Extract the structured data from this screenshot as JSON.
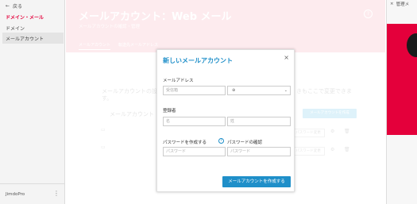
{
  "sidebar": {
    "back_label": "戻る",
    "section_title": "ドメイン・メール",
    "items": [
      {
        "label": "ドメイン"
      },
      {
        "label": "メールアカウント"
      }
    ],
    "footer_brand": "JimdoPro",
    "footer_menu": "⋮"
  },
  "header": {
    "title": "メールアカウント：Web メール",
    "subtitle": "メールアカウントの確認・管理",
    "help": "?",
    "tabs": [
      "メールアカウント",
      "転送先メールアドレス"
    ]
  },
  "background": {
    "intro": "メールアカウントの設",
    "intro_tail": "きもここで変更できま",
    "intro_line2": "す。",
    "list_heading": "メールアカウント",
    "create_button": "メールアカウントを作成",
    "row_button": "パスワード変更"
  },
  "modal": {
    "title": "新しいメールアカウント",
    "close": "×",
    "email_label": "メールアドレス",
    "local_placeholder": "受信箱",
    "domain_icon": "at-icon",
    "domain_value": "",
    "owner_label": "登録者",
    "first_name_placeholder": "名",
    "last_name_placeholder": "姓",
    "password_label": "パスワードを作成する",
    "confirm_label": "パスワードの確認",
    "password_placeholder": "パスワード",
    "confirm_placeholder": "パスワード",
    "submit_label": "メールアカウントを作成する"
  },
  "right_panel": {
    "close": "×",
    "title": "管理メ"
  },
  "colors": {
    "brand_red": "#e4003b",
    "accent_blue": "#1f8fc9",
    "hero_bg": "#fbd7dc"
  }
}
